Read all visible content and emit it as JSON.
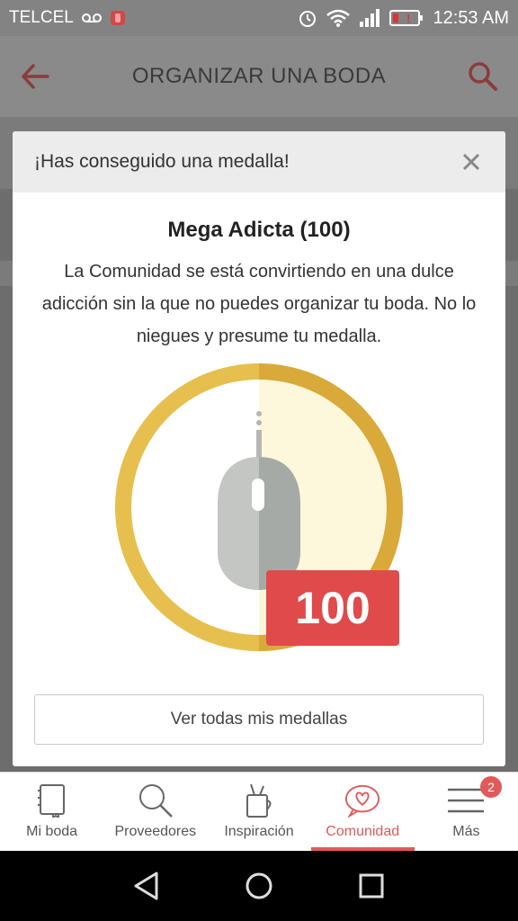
{
  "status_bar": {
    "carrier": "TELCEL",
    "time": "12:53 AM"
  },
  "app_bar": {
    "title": "ORGANIZAR UNA BODA"
  },
  "dialog": {
    "header": "¡Has conseguido una medalla!",
    "medal_title": "Mega Adicta (100)",
    "description": "La Comunidad se está convirtiendo en una dulce adicción sin la que no puedes organizar tu boda. No lo niegues y presume tu medalla.",
    "badge_value": "100",
    "button_label": "Ver todas mis medallas"
  },
  "bottom_nav": {
    "items": [
      {
        "label": "Mi boda",
        "icon": "notebook-icon"
      },
      {
        "label": "Proveedores",
        "icon": "search-icon"
      },
      {
        "label": "Inspiración",
        "icon": "cup-icon"
      },
      {
        "label": "Comunidad",
        "icon": "heart-chat-icon"
      },
      {
        "label": "Más",
        "icon": "menu-icon"
      }
    ],
    "more_badge": "2"
  },
  "colors": {
    "accent": "#e05a5a",
    "medal_gold": "#e6bf4f",
    "medal_cream": "#fdf8dc"
  }
}
